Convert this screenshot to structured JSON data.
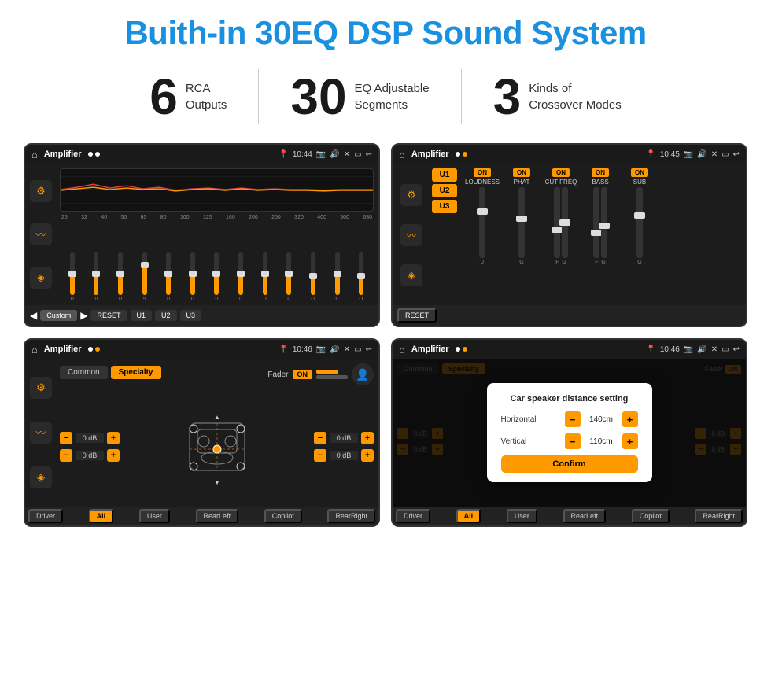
{
  "page": {
    "title": "Buith-in 30EQ DSP Sound System"
  },
  "stats": [
    {
      "number": "6",
      "line1": "RCA",
      "line2": "Outputs"
    },
    {
      "number": "30",
      "line1": "EQ Adjustable",
      "line2": "Segments"
    },
    {
      "number": "3",
      "line1": "Kinds of",
      "line2": "Crossover Modes"
    }
  ],
  "screens": {
    "eq": {
      "title": "Amplifier",
      "time": "10:44",
      "freq_labels": [
        "25",
        "32",
        "40",
        "50",
        "63",
        "80",
        "100",
        "125",
        "160",
        "200",
        "250",
        "320",
        "400",
        "500",
        "630"
      ],
      "slider_values": [
        "0",
        "0",
        "0",
        "5",
        "0",
        "0",
        "0",
        "0",
        "0",
        "0",
        "-1",
        "0",
        "-1"
      ],
      "buttons": [
        "Custom",
        "RESET",
        "U1",
        "U2",
        "U3"
      ]
    },
    "crossover": {
      "title": "Amplifier",
      "time": "10:45",
      "presets": [
        "U1",
        "U2",
        "U3"
      ],
      "channels": [
        "LOUDNESS",
        "PHAT",
        "CUT FREQ",
        "BASS",
        "SUB"
      ],
      "reset_label": "RESET"
    },
    "fader": {
      "title": "Amplifier",
      "time": "10:46",
      "tabs": [
        "Common",
        "Specialty"
      ],
      "fader_label": "Fader",
      "on_label": "ON",
      "vol_values": [
        "0 dB",
        "0 dB",
        "0 dB",
        "0 dB"
      ],
      "bottom_btns": [
        "Driver",
        "All",
        "User",
        "RearLeft",
        "Copilot",
        "RearRight"
      ]
    },
    "dialog": {
      "title": "Amplifier",
      "time": "10:46",
      "dialog_title": "Car speaker distance setting",
      "horizontal_label": "Horizontal",
      "horizontal_value": "140cm",
      "vertical_label": "Vertical",
      "vertical_value": "110cm",
      "confirm_label": "Confirm"
    }
  }
}
